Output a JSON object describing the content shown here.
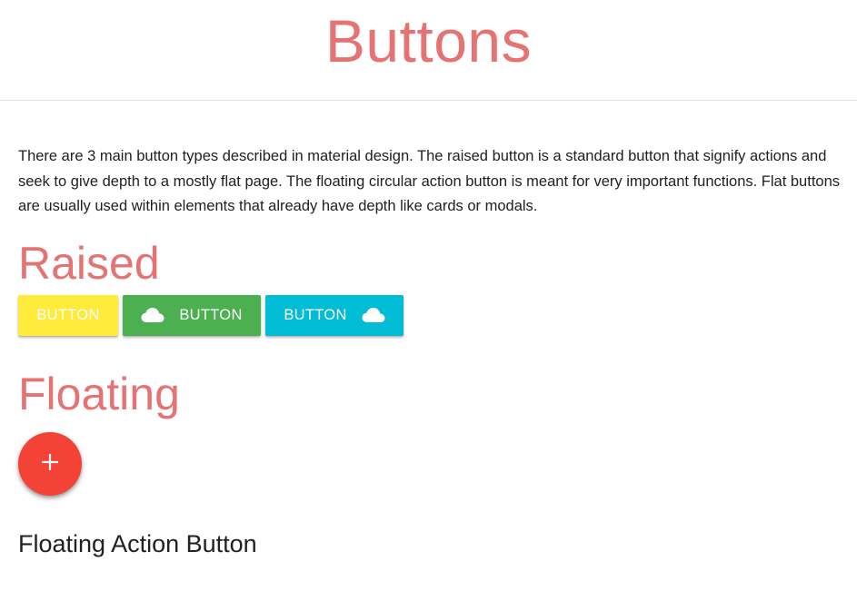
{
  "page": {
    "title": "Buttons",
    "intro": "There are 3 main button types described in material design. The raised button is a standard button that signify actions and seek to give depth to a mostly flat page. The floating circular action button is meant for very important functions. Flat buttons are usually used within elements that already have depth like cards or modals."
  },
  "raised": {
    "heading": "Raised",
    "buttons": [
      {
        "label": "BUTTON",
        "color": "#ffeb3b",
        "icon": null
      },
      {
        "label": "BUTTON",
        "color": "#4caf50",
        "icon": "cloud-icon",
        "icon_position": "left"
      },
      {
        "label": "BUTTON",
        "color": "#00bcd4",
        "icon": "cloud-icon",
        "icon_position": "right"
      }
    ]
  },
  "floating": {
    "heading": "Floating",
    "fab_icon": "plus-icon",
    "fab_symbol": "+",
    "fab_color": "#f44336",
    "subheading": "Floating Action Button"
  },
  "colors": {
    "accent": "#e57373",
    "text": "#212121"
  }
}
